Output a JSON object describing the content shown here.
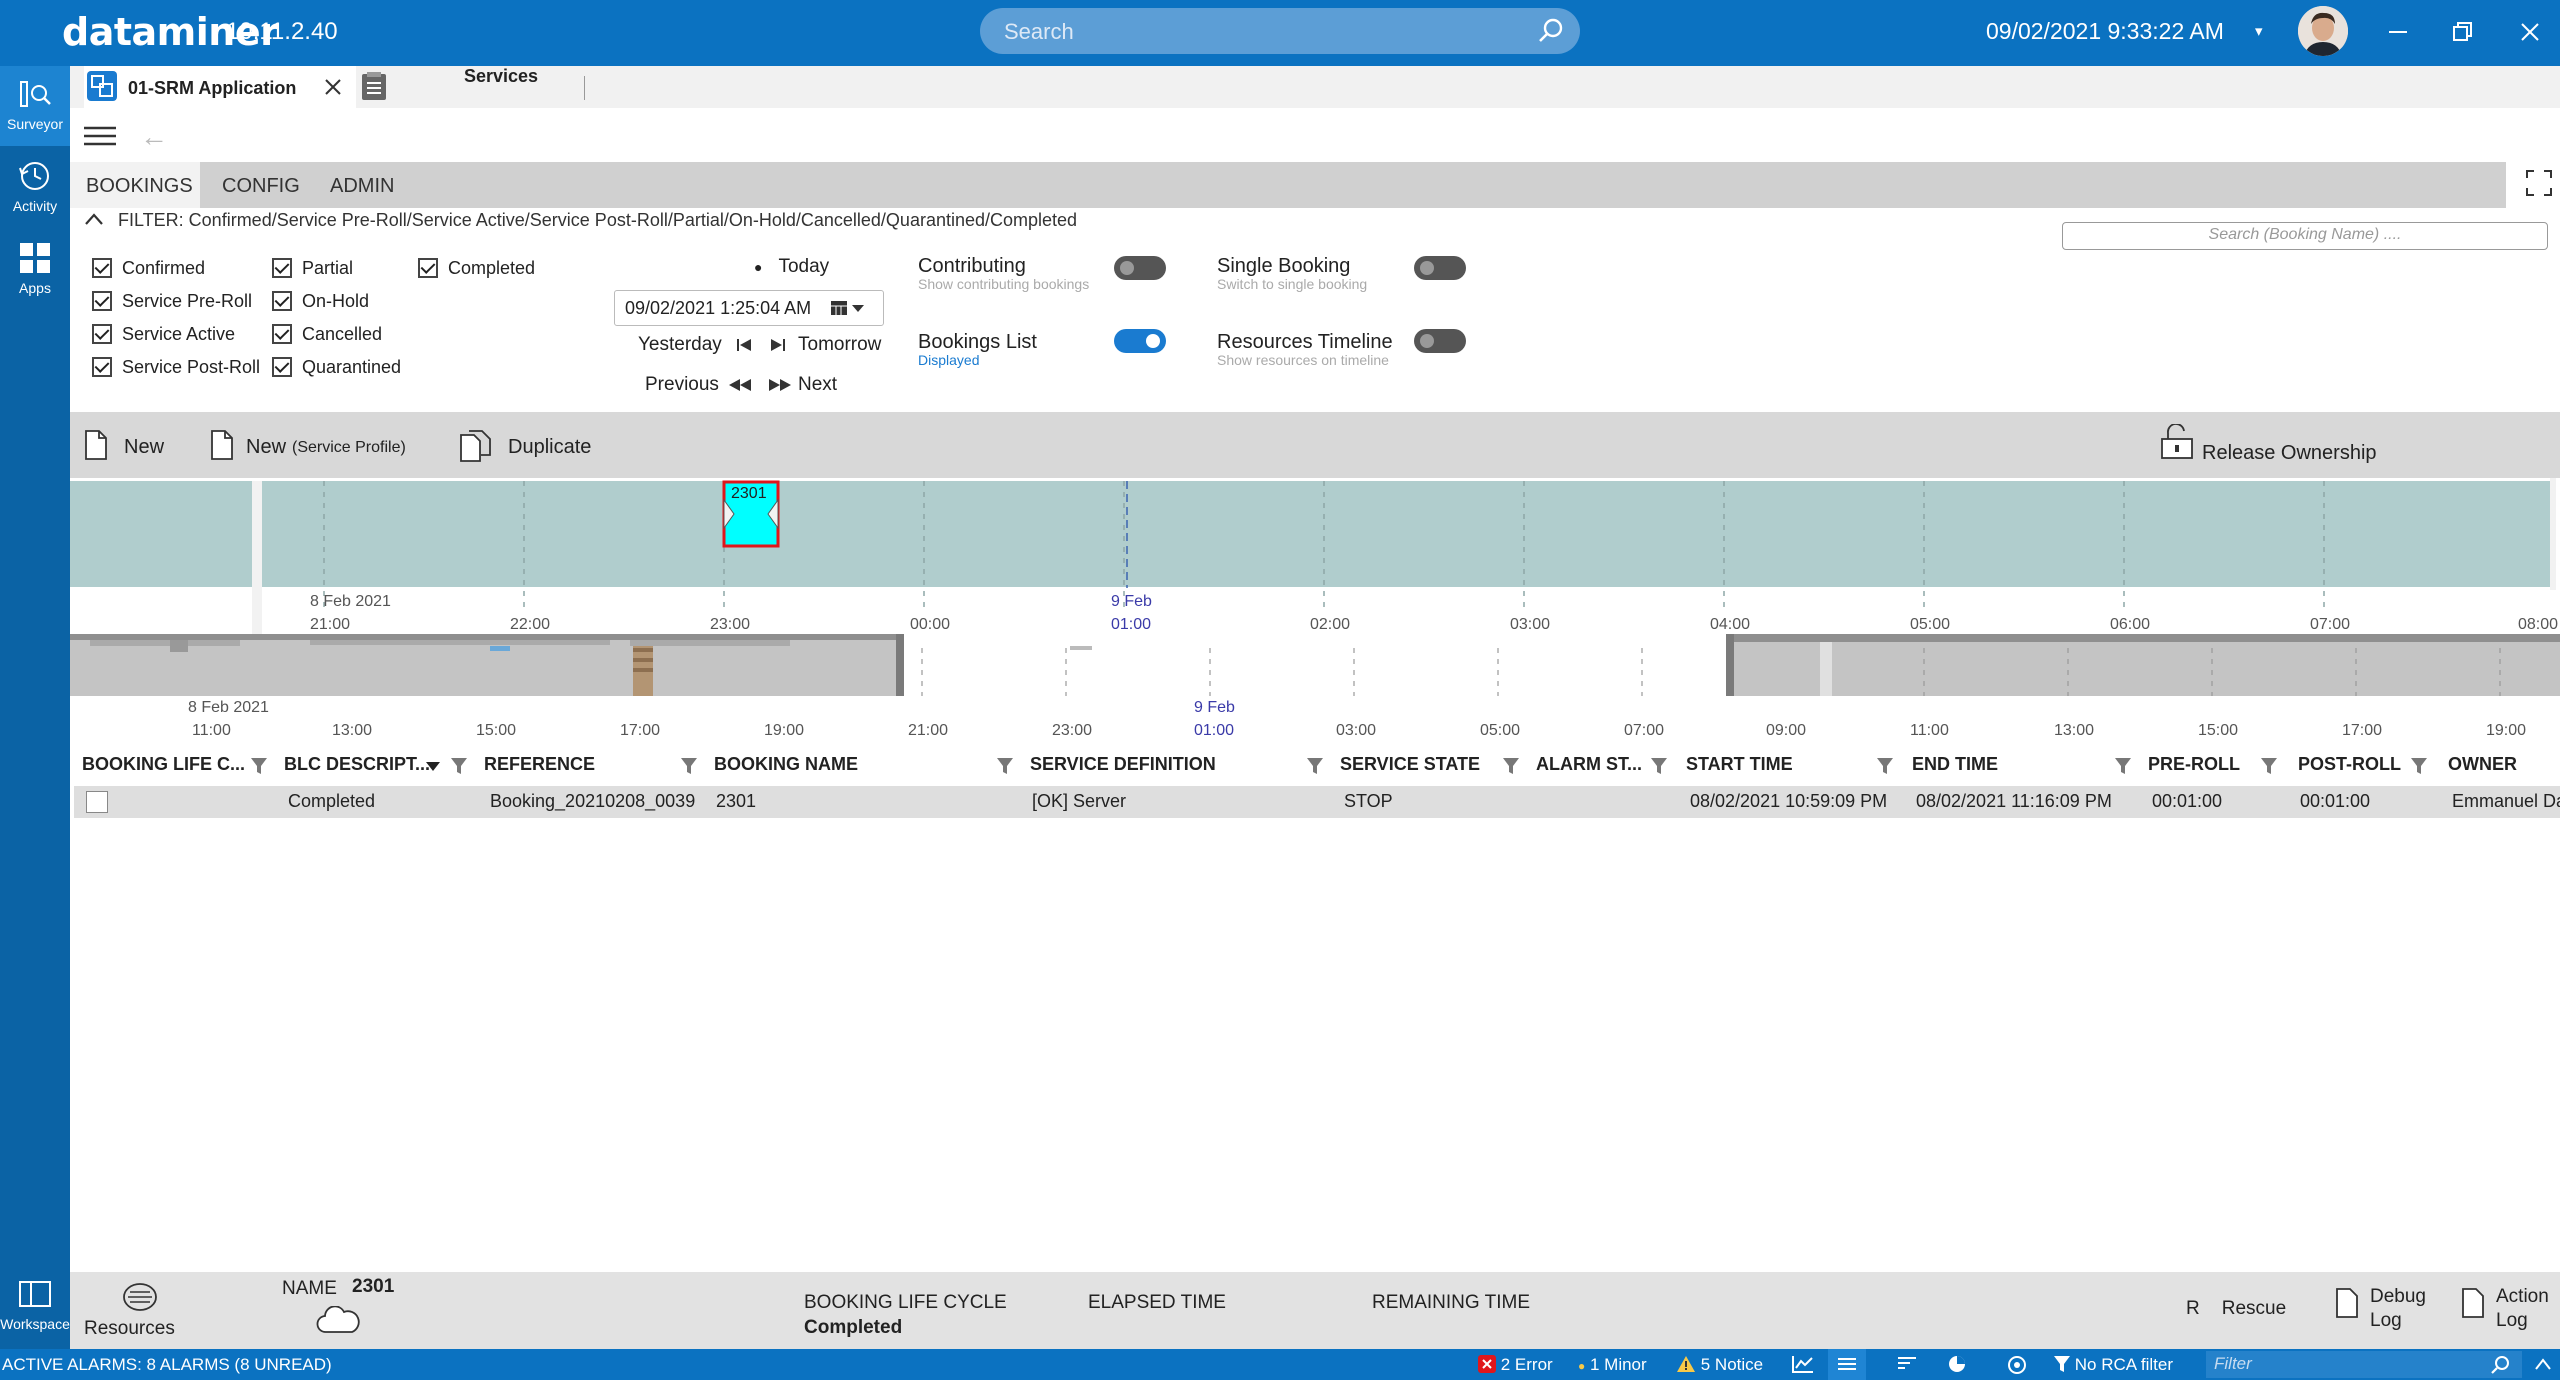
{
  "header": {
    "logo": "dataminer",
    "version": "10.11.2.40",
    "search_placeholder": "Search",
    "datetime": "09/02/2021 9:33:22 AM"
  },
  "rail": {
    "items": [
      {
        "label": "Surveyor",
        "icon": "surveyor-icon"
      },
      {
        "label": "Activity",
        "icon": "activity-icon"
      },
      {
        "label": "Apps",
        "icon": "apps-icon"
      }
    ],
    "workspace": "Workspace"
  },
  "doc_tabs": [
    {
      "label": "01-SRM Application",
      "active": true
    },
    {
      "label": "Services",
      "active": false
    }
  ],
  "app_tabs": [
    "BOOKINGS",
    "CONFIG",
    "ADMIN"
  ],
  "filter": {
    "text": "FILTER: Confirmed/Service Pre-Roll/Service Active/Service Post-Roll/Partial/On-Hold/Cancelled/Quarantined/Completed",
    "search_placeholder": "Search (Booking Name) ...."
  },
  "checkboxes": {
    "col1": [
      "Confirmed",
      "Service Pre-Roll",
      "Service Active",
      "Service Post-Roll"
    ],
    "col2": [
      "Partial",
      "On-Hold",
      "Cancelled",
      "Quarantined"
    ],
    "col3": [
      "Completed"
    ]
  },
  "date_nav": {
    "today": "Today",
    "date_value": "09/02/2021 1:25:04 AM",
    "yesterday": "Yesterday",
    "tomorrow": "Tomorrow",
    "previous": "Previous",
    "next": "Next"
  },
  "toggles": {
    "contributing": {
      "label": "Contributing",
      "sub": "Show contributing bookings",
      "on": false
    },
    "single_booking": {
      "label": "Single Booking",
      "sub": "Switch to single booking",
      "on": false
    },
    "bookings_list": {
      "label": "Bookings List",
      "sub": "Displayed",
      "on": true
    },
    "resources_timeline": {
      "label": "Resources Timeline",
      "sub": "Show resources on timeline",
      "on": false
    }
  },
  "actions": {
    "new": "New",
    "new_profile": "New",
    "new_profile_suffix": "(Service Profile)",
    "duplicate": "Duplicate",
    "release": "Release Ownership"
  },
  "timeline": {
    "booking_label": "2301",
    "main_date_left": "8 Feb 2021",
    "main_date_mid": "9 Feb",
    "main_ticks": [
      "21:00",
      "22:00",
      "23:00",
      "00:00",
      "01:00",
      "02:00",
      "03:00",
      "04:00",
      "05:00",
      "06:00",
      "07:00",
      "08:00"
    ],
    "overview_date_left": "8 Feb 2021",
    "overview_date_mid": "9 Feb",
    "overview_ticks": [
      "11:00",
      "13:00",
      "15:00",
      "17:00",
      "19:00",
      "21:00",
      "23:00",
      "01:00",
      "03:00",
      "05:00",
      "07:00",
      "09:00",
      "11:00",
      "13:00",
      "15:00",
      "17:00",
      "19:00"
    ]
  },
  "grid": {
    "columns": [
      "BOOKING LIFE C...",
      "BLC DESCRIPT...",
      "REFERENCE",
      "BOOKING NAME",
      "SERVICE DEFINITION",
      "SERVICE STATE",
      "ALARM ST...",
      "START TIME",
      "END TIME",
      "PRE-ROLL",
      "POST-ROLL",
      "OWNER"
    ],
    "rows": [
      {
        "blc_description": "Completed",
        "reference": "Booking_20210208_0039",
        "booking_name": "2301",
        "service_definition": "[OK] Server",
        "service_state": "STOP",
        "start_time": "08/02/2021 10:59:09 PM",
        "end_time": "08/02/2021 11:16:09 PM",
        "pre_roll": "00:01:00",
        "post_roll": "00:01:00",
        "owner": "Emmanuel Da"
      }
    ]
  },
  "bottom": {
    "resources": "Resources",
    "name_label": "NAME",
    "name_value": "2301",
    "blc_label": "BOOKING LIFE CYCLE",
    "blc_value": "Completed",
    "elapsed": "ELAPSED TIME",
    "remaining": "REMAINING TIME",
    "r": "R",
    "rescue": "Rescue",
    "debug_1": "Debug",
    "debug_2": "Log",
    "action_1": "Action",
    "action_2": "Log"
  },
  "status": {
    "alarms": "ACTIVE ALARMS: 8 ALARMS (8 UNREAD)",
    "error": "2 Error",
    "minor": "1 Minor",
    "notice": "5 Notice",
    "rca": "No RCA filter",
    "filter_placeholder": "Filter"
  },
  "colors": {
    "brand": "#0b72c1",
    "rail": "#0b63a5",
    "timeline_band": "#b0cdcd",
    "booking_fill": "#00ffff",
    "booking_border": "#e0161b"
  }
}
